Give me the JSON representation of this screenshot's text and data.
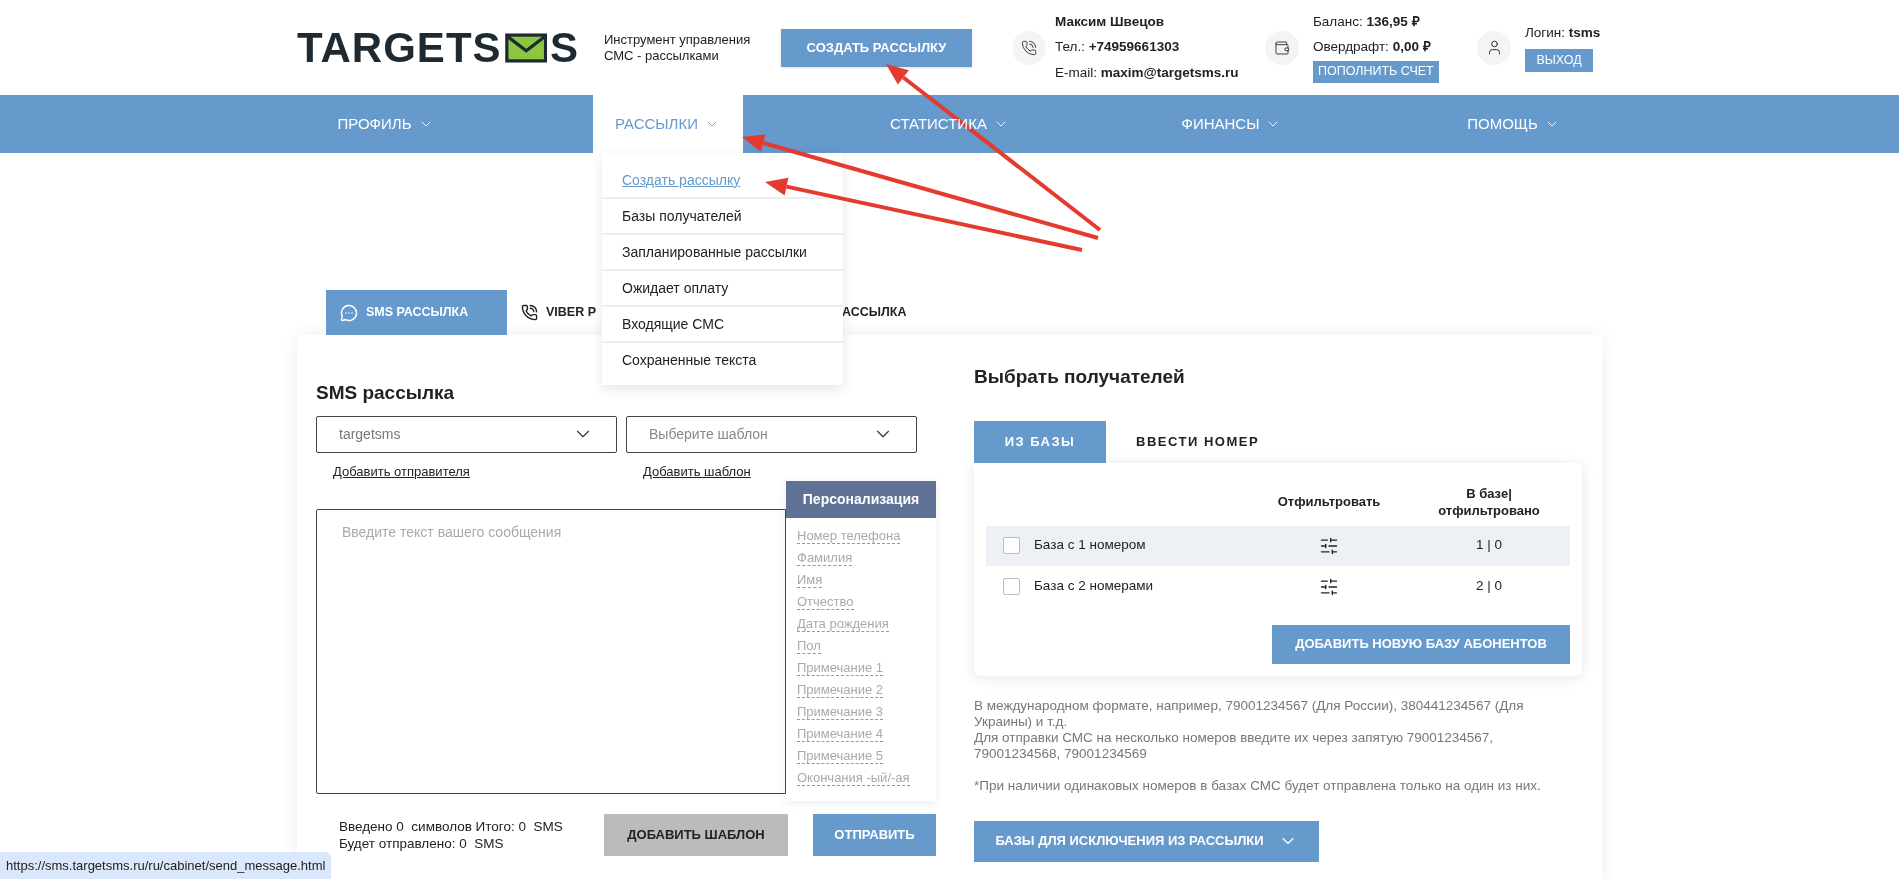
{
  "header": {
    "logo": {
      "before": "TARGETS",
      "after": "S"
    },
    "tagline": "Инструмент управления СМС - рассылками",
    "create_button": "СОЗДАТЬ РАССЫЛКУ",
    "contact": {
      "name": "Максим Швецов",
      "phone_label": "Тел.:",
      "phone": "+74959661303",
      "email_label": "E-mail:",
      "email": "maxim@targetsms.ru"
    },
    "account": {
      "balance_label": "Баланс:",
      "balance": "136,95 ₽",
      "overdraft_label": "Овердрафт:",
      "overdraft": "0,00 ₽",
      "topup_button": "ПОПОЛНИТЬ СЧЕТ"
    },
    "login": {
      "label": "Логин:",
      "value": "tsms",
      "logout_button": "ВЫХОД"
    }
  },
  "nav": [
    {
      "label": "ПРОФИЛЬ",
      "selected": false
    },
    {
      "label": "РАССЫЛКИ",
      "selected": true
    },
    {
      "label": "СТАТИСТИКА",
      "selected": false
    },
    {
      "label": "ФИНАНСЫ",
      "selected": false
    },
    {
      "label": "ПОМОЩЬ",
      "selected": false
    }
  ],
  "menu": [
    {
      "label": "Создать рассылку",
      "selected": true
    },
    {
      "label": "Базы получателей",
      "selected": false
    },
    {
      "label": "Запланированные рассылки",
      "selected": false
    },
    {
      "label": "Ожидает оплату",
      "selected": false
    },
    {
      "label": "Входящие СМС",
      "selected": false
    },
    {
      "label": "Сохраненные текста",
      "selected": false
    }
  ],
  "tabs": [
    {
      "label": "SMS РАССЫЛКА",
      "selected": true,
      "kind": "chat"
    },
    {
      "label": "VIBER Р",
      "selected": false,
      "kind": "viber"
    },
    {
      "label": "АССЫЛКА",
      "selected": false,
      "kind": "plain"
    }
  ],
  "sms": {
    "title": "SMS рассылка",
    "sender": "targetsms",
    "template_placeholder": "Выберите шаблон",
    "add_sender_link": "Добавить отправителя",
    "add_template_link": "Добавить шаблон",
    "message_placeholder": "Введите текст вашего сообщения",
    "personalization": {
      "title": "Персонализация",
      "items": [
        "Номер телефона",
        "Фамилия",
        "Имя",
        "Отчество",
        "Дата рождения",
        "Пол",
        "Примечание 1",
        "Примечание 2",
        "Примечание 3",
        "Примечание 4",
        "Примечание 5",
        "Окончания -ый/-ая"
      ]
    },
    "counters": [
      "Введено 0  символов Итого: 0  SMS",
      "Будет отправлено: 0  SMS"
    ],
    "save_template_button": "ДОБАВИТЬ ШАБЛОН",
    "send_button": "ОТПРАВИТЬ"
  },
  "recipients": {
    "title": "Выбрать получателей",
    "tabs": [
      {
        "label": "ИЗ БАЗЫ",
        "selected": true
      },
      {
        "label": "ВВЕСТИ НОМЕР",
        "selected": false
      }
    ],
    "table": {
      "columns": [
        "Отфильтровать",
        "В базе| отфильтровано"
      ],
      "rows": [
        {
          "name": "База с 1 номером",
          "checked": false,
          "highlighted": true,
          "count": "1 | 0"
        },
        {
          "name": "База с 2 номерами",
          "checked": false,
          "highlighted": false,
          "count": "2 | 0"
        }
      ]
    },
    "add_base_button": "ДОБАВИТЬ НОВУЮ БАЗУ АБОНЕНТОВ",
    "notes": [
      "В международном формате, например, 79001234567 (Для России), 380441234567 (Для Украины) и т.д.",
      "Для отправки СМС на несколько номеров введите их через запятую 79001234567, 79001234568, 79001234569"
    ],
    "footnote": "*При наличии одинаковых номеров в базах СМС будет отправлена только на один из них.",
    "exclude_button": "БАЗЫ ДЛЯ ИСКЛЮЧЕНИЯ ИЗ РАССЫЛКИ"
  },
  "status_url": "https://sms.targetsms.ru/ru/cabinet/send_message.html"
}
